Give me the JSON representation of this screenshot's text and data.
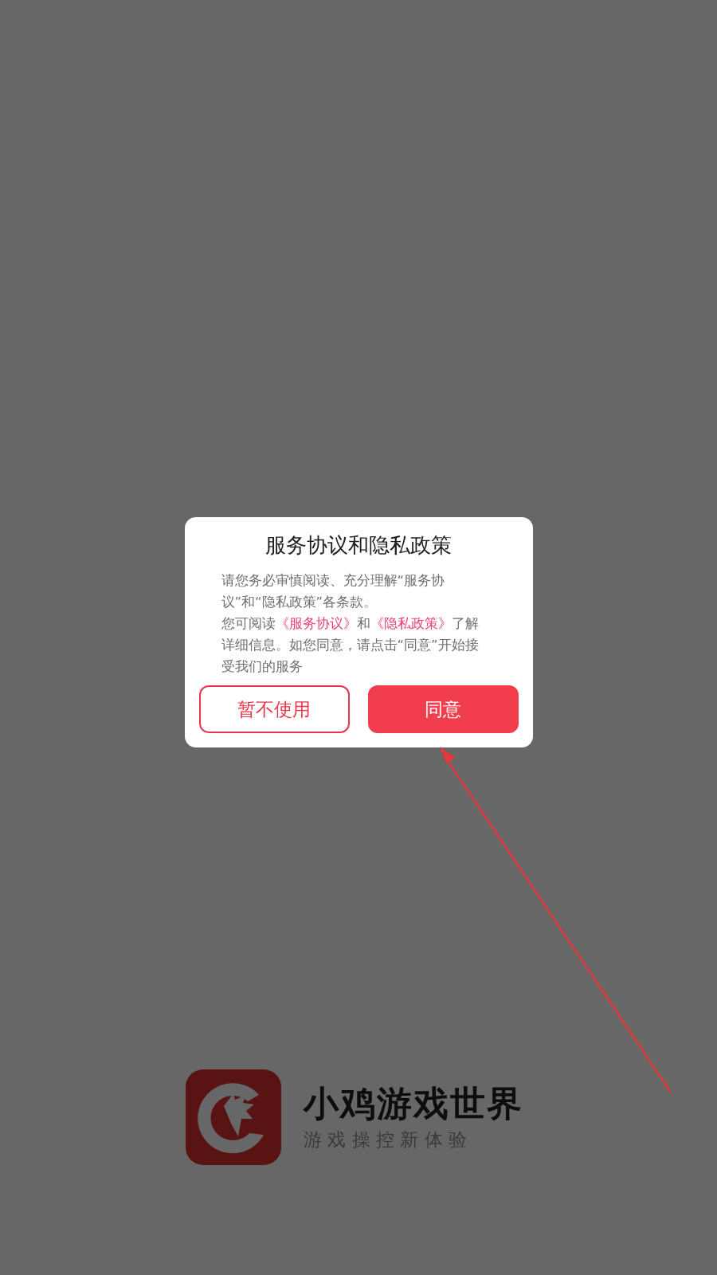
{
  "dialog": {
    "title": "服务协议和隐私政策",
    "body_lines": [
      [
        {
          "kind": "text",
          "text": "请您务必审慎阅读、充分理解“服务协"
        }
      ],
      [
        {
          "kind": "text",
          "text": "议”和“隐私政策”各条款。"
        }
      ],
      [
        {
          "kind": "text",
          "text": "您可阅读"
        },
        {
          "kind": "link",
          "text": "《服务协议》"
        },
        {
          "kind": "text",
          "text": "和"
        },
        {
          "kind": "link",
          "text": "《隐私政策》"
        },
        {
          "kind": "text",
          "text": "了解"
        }
      ],
      [
        {
          "kind": "text",
          "text": "详细信息。如您同意，请点击“同意”开始接"
        }
      ],
      [
        {
          "kind": "text",
          "text": "受我们的服务"
        }
      ]
    ],
    "buttons": [
      {
        "label": "暂不使用",
        "kind": "outline"
      },
      {
        "label": "同意",
        "kind": "filled"
      }
    ]
  },
  "brand": {
    "name": "小鸡游戏世界",
    "tagline": "游 戏 操 控 新 体 验"
  }
}
